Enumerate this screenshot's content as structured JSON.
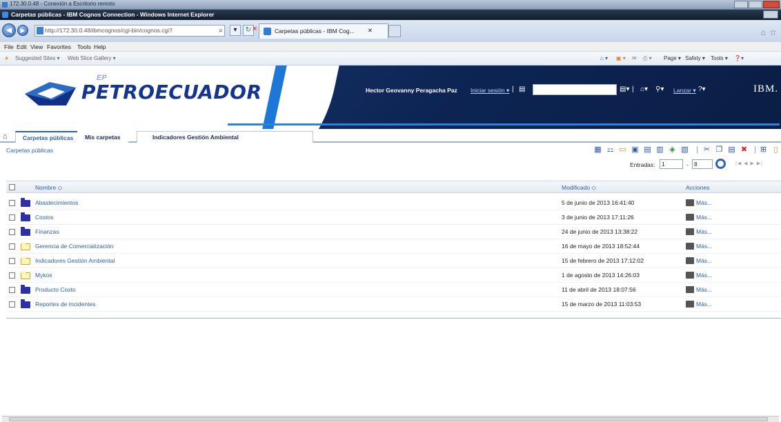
{
  "rdp": {
    "title": "172.30.0.48 - Conexión a Escritorio remoto"
  },
  "window": {
    "title": "Carpetas públicas - IBM Cognos Connection - Windows Internet Explorer"
  },
  "address": {
    "url": "http://172.30.0.48/ibmcognos/cgi-bin/cognos.cgi?"
  },
  "browser_tab": {
    "label": "Carpetas públicas - IBM Cog..."
  },
  "menu": [
    "File",
    "Edit",
    "View",
    "Favorites",
    "Tools",
    "Help"
  ],
  "favorites": {
    "suggested": "Suggested Sites ▾",
    "gallery": "Web Slice Gallery ▾"
  },
  "commands": {
    "page": "Page ▾",
    "safety": "Safety ▾",
    "tools": "Tools ▾"
  },
  "banner": {
    "logo": "PETROECUADOR",
    "logo_prefix": "EP",
    "user": "Hector Geovanny Peragacha Paz",
    "logout": "Iniciar sesión",
    "launch": "Lanzar",
    "brand": "IBM."
  },
  "tabs": [
    "Carpetas públicas",
    "Mis carpetas",
    "Indicadores Gestión Ambiental"
  ],
  "breadcrumb": "Carpetas públicas",
  "entries": {
    "label": "Entradas:",
    "from": "1",
    "to": "8"
  },
  "table": {
    "headers": {
      "name": "Nombre",
      "modified": "Modificado",
      "actions": "Acciones"
    },
    "rows": [
      {
        "name": "Abastecimientos",
        "date": "5 de junio de 2013 16:41:40",
        "color": "blue",
        "action": "Más..."
      },
      {
        "name": "Costos",
        "date": "3 de junio de 2013 17:11:26",
        "color": "blue",
        "action": "Más..."
      },
      {
        "name": "Finanzas",
        "date": "24 de junio de 2013 13:38:22",
        "color": "blue",
        "action": "Más..."
      },
      {
        "name": "Gerencia de Comercialización",
        "date": "16 de mayo de 2013 18:52:44",
        "color": "yellow",
        "action": "Más..."
      },
      {
        "name": "Indicadores Gestión Ambiental",
        "date": "15 de febrero de 2013 17:12:02",
        "color": "yellow",
        "action": "Más..."
      },
      {
        "name": "Mykos",
        "date": "1 de agosto de 2013 14:26:03",
        "color": "yellow",
        "action": "Más..."
      },
      {
        "name": "Producto Costo",
        "date": "11 de abril de 2013 18:07:56",
        "color": "blue",
        "action": "Más..."
      },
      {
        "name": "Reportes de Incidentes",
        "date": "15 de marzo de 2013 11:03:53",
        "color": "blue",
        "action": "Más..."
      }
    ]
  }
}
